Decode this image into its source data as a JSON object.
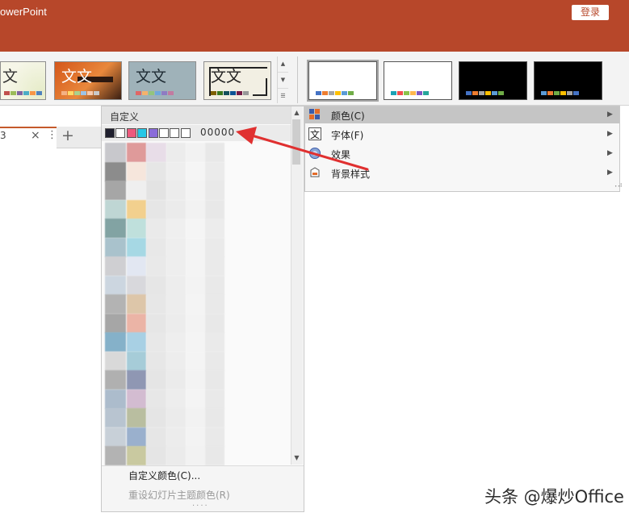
{
  "app_title": "owerPoint",
  "login_label": "登录",
  "colors": {
    "title_bar": "#b7472a",
    "accent": "#c55a2b",
    "annotation_arrow": "#e03030"
  },
  "design_gallery": {
    "themes": [
      {
        "text": "文",
        "background": "#f6f6e8",
        "text_color": "#333333"
      },
      {
        "text": "文文",
        "background": "#d4561a",
        "text_color": "#ffffff"
      },
      {
        "text": "文文",
        "background": "#9fb2b9",
        "text_color": "#1e2b33"
      },
      {
        "text": "文文",
        "background": "#f2efe3",
        "text_color": "#222222"
      }
    ],
    "variants": [
      {
        "background": "#ffffff"
      },
      {
        "background": "#ffffff"
      },
      {
        "background": "#000000"
      },
      {
        "background": "#000000"
      }
    ]
  },
  "document_tab": {
    "label": "3",
    "close_icon": "×",
    "more_icon": "⋮",
    "add_icon": "+"
  },
  "color_panel": {
    "header": "自定义",
    "custom_colors": [
      "#1f1f2e",
      "#ffffff",
      "#ee5a7d",
      "#26c7e6",
      "#8a6cd9",
      "#ffffff",
      "#ffffff",
      "#ffffff"
    ],
    "hex_value": "00000",
    "scroll_up_icon": "▲",
    "scroll_down_icon": "▼",
    "footer_items": [
      {
        "label": "自定义颜色(C)...",
        "enabled": true
      },
      {
        "label": "重设幻灯片主题颜色(R)",
        "enabled": false
      }
    ],
    "grip": "....",
    "blurred_palette": [
      [
        "#c8c8cc",
        "#df9a9a",
        "#e8dde8",
        "#ececec",
        "#f2f2f2",
        "#e8e8e8"
      ],
      [
        "#8c8c8c",
        "#f6e6dc",
        "#e6e6e6",
        "#eeeeee",
        "#f5f5f5",
        "#ebebeb"
      ],
      [
        "#a6a6a6",
        "#efefef",
        "#e3e3e3",
        "#ececec",
        "#f3f3f3",
        "#e9e9e9"
      ],
      [
        "#bfd6d4",
        "#f2d08e",
        "#e6e6e6",
        "#ebebeb",
        "#f2f2f2",
        "#e8e8e8"
      ],
      [
        "#82a3a3",
        "#bfe0dc",
        "#eaeaea",
        "#efefef",
        "#f5f5f5",
        "#ececec"
      ],
      [
        "#a9c2cc",
        "#a6d8e4",
        "#e8e8e8",
        "#eeeeee",
        "#f4f4f4",
        "#eaeaea"
      ],
      [
        "#cfcfd2",
        "#e2e7f2",
        "#e9e9e9",
        "#eeeeee",
        "#f4f4f4",
        "#eaeaea"
      ],
      [
        "#ccd6e0",
        "#d8d8dc",
        "#e6e6e6",
        "#ededed",
        "#f3f3f3",
        "#e9e9e9"
      ],
      [
        "#b3b3b3",
        "#ddc6a9",
        "#e7e7e7",
        "#ededed",
        "#f4f4f4",
        "#e9e9e9"
      ],
      [
        "#a6a6a6",
        "#ebb4a6",
        "#e6e6e6",
        "#ececec",
        "#f3f3f3",
        "#e8e8e8"
      ],
      [
        "#85b1c9",
        "#a8d0e4",
        "#e8e8e8",
        "#eeeeee",
        "#f4f4f4",
        "#eaeaea"
      ],
      [
        "#d9d9d9",
        "#a6ccd8",
        "#e7e7e7",
        "#ededed",
        "#f4f4f4",
        "#e9e9e9"
      ],
      [
        "#b0b0b0",
        "#8f97b3",
        "#e5e5e5",
        "#ebebeb",
        "#f3f3f3",
        "#e8e8e8"
      ],
      [
        "#acbccc",
        "#d3bcd1",
        "#e7e7e7",
        "#ededed",
        "#f4f4f4",
        "#e9e9e9"
      ],
      [
        "#b8c4d0",
        "#b9bea0",
        "#e5e5e5",
        "#ebebeb",
        "#f2f2f2",
        "#e8e8e8"
      ],
      [
        "#c8d0d8",
        "#9ab0cd",
        "#e6e6e6",
        "#ececec",
        "#f3f3f3",
        "#e9e9e9"
      ],
      [
        "#b3b3b3",
        "#c9c9a0",
        "#e5e5e5",
        "#ebebeb",
        "#f2f2f2",
        "#e8e8e8"
      ]
    ]
  },
  "variant_menu": {
    "items": [
      {
        "label": "颜色(C)",
        "icon": "color-palette-icon",
        "highlighted": true
      },
      {
        "label": "字体(F)",
        "icon": "font-icon",
        "highlighted": false
      },
      {
        "label": "效果",
        "icon": "effects-icon",
        "highlighted": false
      },
      {
        "label": "背景样式",
        "icon": "background-style-icon",
        "highlighted": false
      }
    ],
    "arrow_icon": "▶"
  },
  "watermark": "头条 @爆炒Office"
}
